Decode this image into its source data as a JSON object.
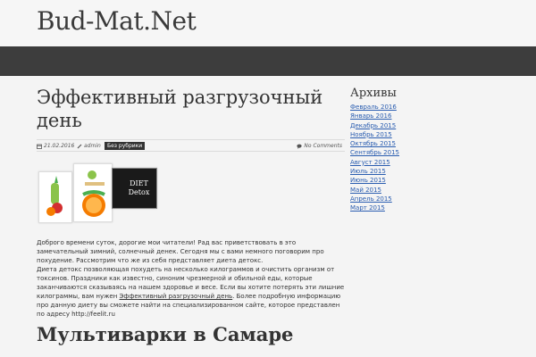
{
  "site": {
    "title": "Bud-Mat.Net"
  },
  "post": {
    "title": "Эффективный разгрузочный день",
    "date": "21.02.2016",
    "author": "admin",
    "category": "Без рубрики",
    "comments": "No Comments",
    "image_text": "DIET Detox",
    "body_parts": [
      "Доброго времени суток, дорогие мои читатели! Рад вас приветствовать в это замечательный зимний, солнечный денек. Сегодня мы с вами немного поговорим про похудение. Рассмотрим что же из себя представляет диета детокс.",
      "Диета детокс позволяющая похудеть на несколько килограммов и очистить организм от токсинов. Праздники как известно, синоним чрезмерной и обильной еды, которые заканчиваются сказываясь на нашем здоровье и весе. Если вы хотите потерять эти лишние килограммы, вам нужен ",
      "Эффективный разгрузочный день",
      ". Более подробную информацию про данную диету вы сможете найти на специализированном сайте, которое представлен по адресу http://feelit.ru"
    ]
  },
  "next_post": {
    "title": "Мультиварки в Самаре"
  },
  "sidebar": {
    "widget_title": "Архивы",
    "archives": [
      "Февраль 2016",
      "Январь 2016",
      "Декабрь 2015",
      "Ноябрь 2015",
      "Октябрь 2015",
      "Сентябрь 2015",
      "Август 2015",
      "Июль 2015",
      "Июнь 2015",
      "Май 2015",
      "Апрель 2015",
      "Март 2015"
    ]
  },
  "colors": {
    "nav": "#3d3d3d",
    "link": "#2a5db0",
    "category_badge": "#333333"
  }
}
